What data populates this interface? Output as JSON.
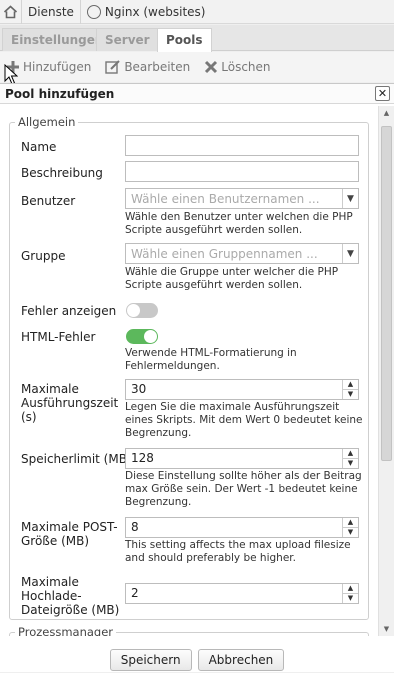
{
  "breadcrumb": {
    "items": [
      "Dienste",
      "Nginx (websites)"
    ]
  },
  "tabs": [
    "Einstellungen",
    "Server",
    "Pools"
  ],
  "active_tab": "Pools",
  "toolbar": {
    "add": "Hinzufügen",
    "edit": "Bearbeiten",
    "delete": "Löschen"
  },
  "dialog": {
    "title": "Pool hinzufügen",
    "close": "✕",
    "section_general": "Allgemein",
    "section_process": "Prozessmanager",
    "fields": {
      "name": {
        "label": "Name",
        "value": ""
      },
      "description": {
        "label": "Beschreibung",
        "value": ""
      },
      "user": {
        "label": "Benutzer",
        "placeholder": "Wähle einen Benutzernamen ...",
        "help": "Wähle den Benutzer unter welchen die PHP Scripte ausgeführt werden sollen."
      },
      "group": {
        "label": "Gruppe",
        "placeholder": "Wähle einen Gruppennamen ...",
        "help": "Wähle die Gruppe unter welcher die PHP Scripte ausgeführt werden sollen."
      },
      "show_errors": {
        "label": "Fehler anzeigen",
        "enabled": false
      },
      "html_errors": {
        "label": "HTML-Fehler",
        "enabled": true,
        "help": "Verwende HTML-Formatierung in Fehlermeldungen."
      },
      "max_exec_time": {
        "label": "Maximale Ausführungszeit (s)",
        "value": "30",
        "help": "Legen Sie die maximale Ausführungszeit eines Skripts. Mit dem Wert 0 bedeutet keine Begrenzung."
      },
      "memory_limit": {
        "label": "Speicherlimit (MB)",
        "value": "128",
        "help": "Diese Einstellung sollte höher als der Beitrag max Größe sein. Der Wert -1 bedeutet keine Begrenzung."
      },
      "post_max": {
        "label": "Maximale POST-Größe (MB)",
        "value": "8",
        "help": "This setting affects the max upload filesize and should preferably be higher."
      },
      "upload_max": {
        "label": "Maximale Hochlade-Dateigröße (MB)",
        "value": "2"
      }
    },
    "buttons": {
      "save": "Speichern",
      "cancel": "Abbrechen"
    }
  },
  "colors": {
    "toggle_on": "#5cb85c",
    "toggle_off": "#c8c8c8"
  }
}
